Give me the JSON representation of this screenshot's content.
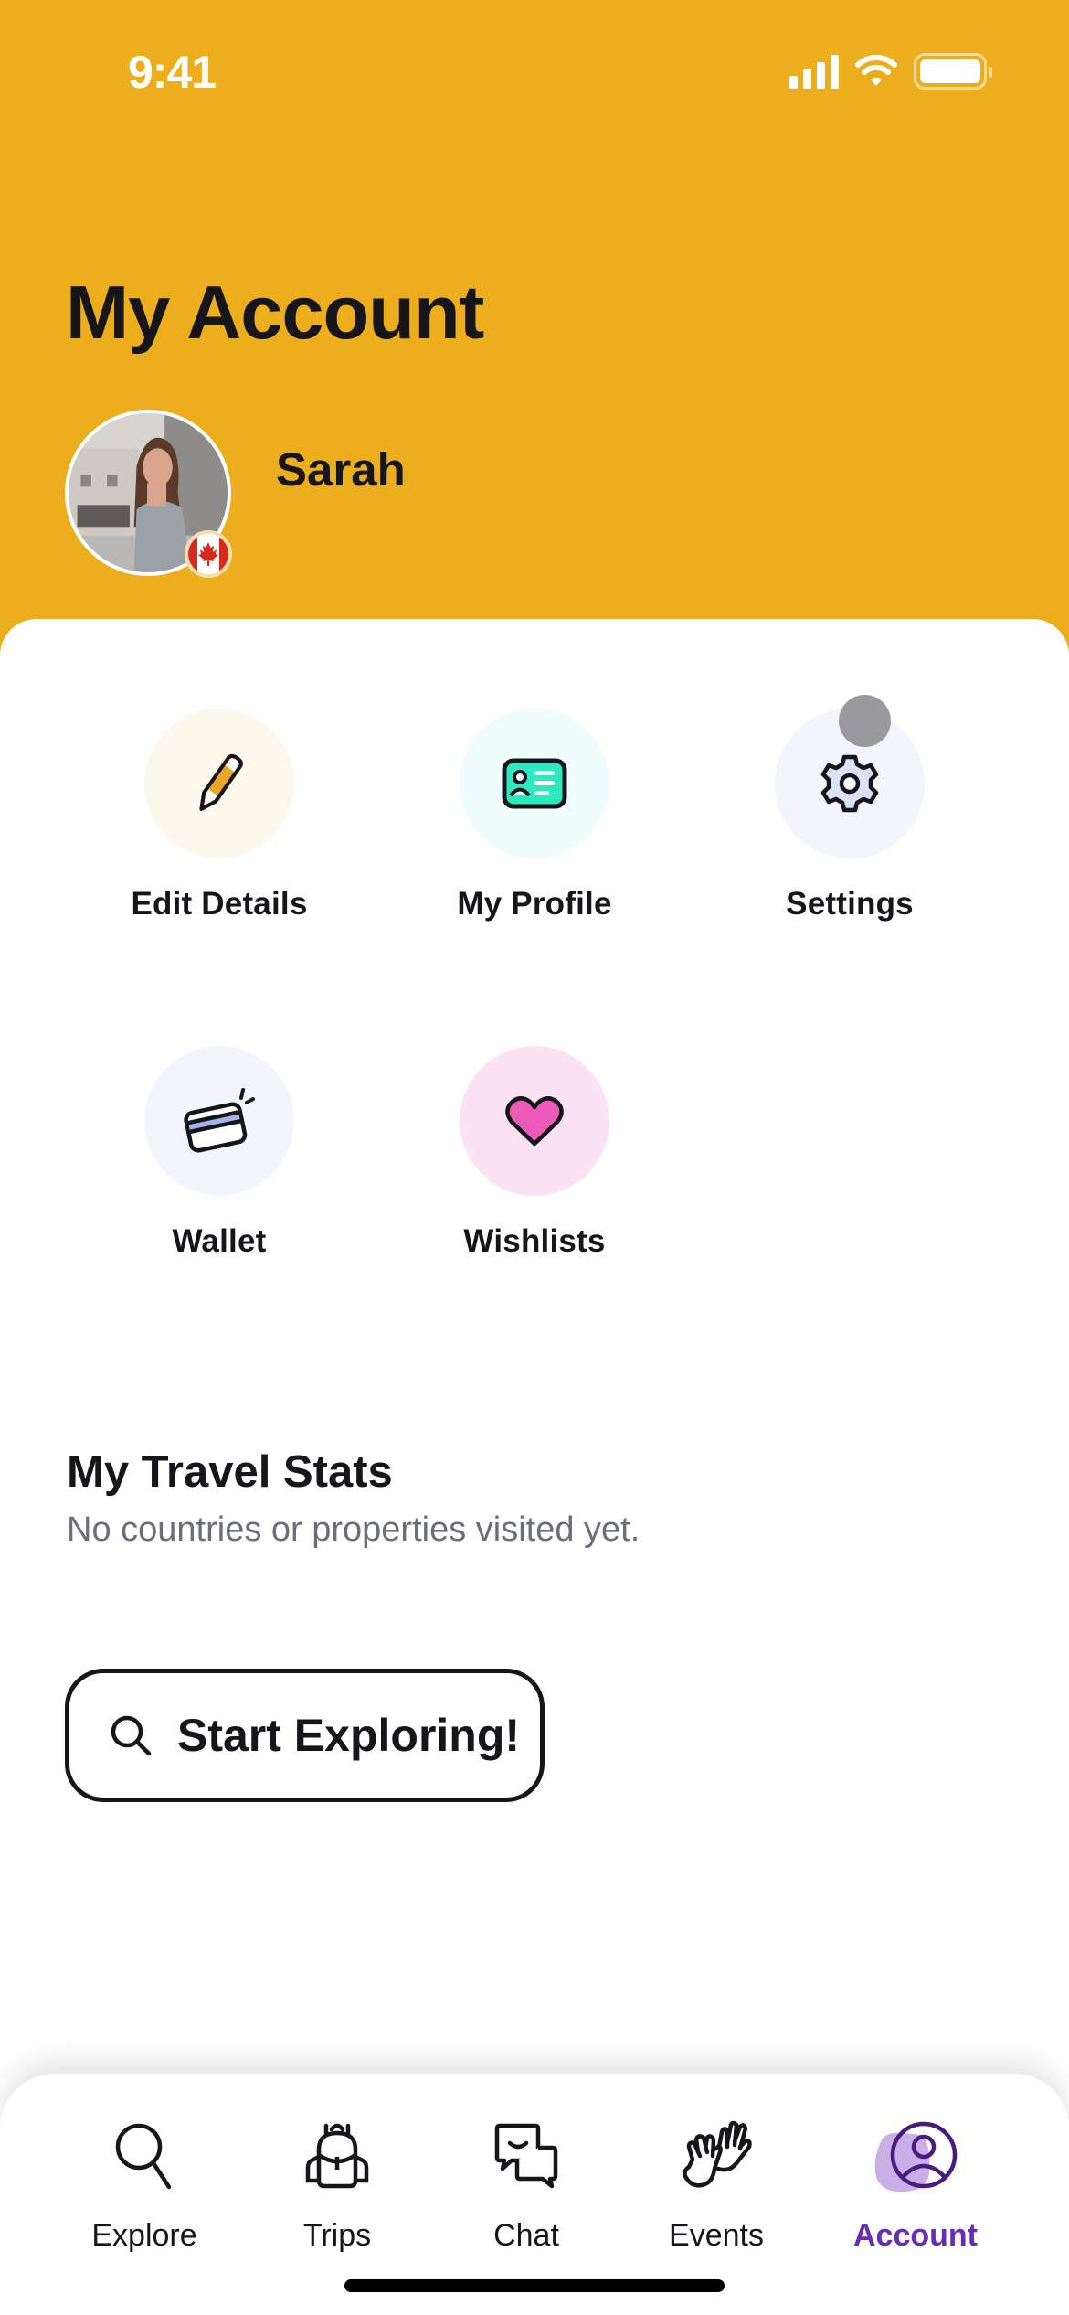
{
  "status_bar": {
    "time": "9:41",
    "icons": [
      "cellular-signal-icon",
      "wifi-icon",
      "battery-icon"
    ]
  },
  "header": {
    "title": "My Account",
    "user": {
      "name": "Sarah",
      "avatar": "profile-photo",
      "country_flag": "Canada"
    }
  },
  "colors": {
    "header_bg": "#ecae1c",
    "accent_purple": "#6a2bb8",
    "text_primary": "#16161a",
    "text_secondary": "#6b6d7a"
  },
  "quick_actions": [
    {
      "label": "Edit Details",
      "icon": "pencil-icon",
      "bg": "#fdf8ec"
    },
    {
      "label": "My Profile",
      "icon": "id-card-icon",
      "bg": "#effefd"
    },
    {
      "label": "Settings",
      "icon": "gear-icon",
      "bg": "#f2f5fe"
    },
    {
      "label": "Wallet",
      "icon": "credit-card-icon",
      "bg": "#f2f5fe"
    },
    {
      "label": "Wishlists",
      "icon": "heart-icon",
      "bg": "#fbe3f5"
    }
  ],
  "travel_stats": {
    "title": "My Travel Stats",
    "subtitle": "No countries or properties visited yet."
  },
  "explore_button": {
    "label": "Start Exploring!",
    "icon": "search-icon"
  },
  "tab_bar": {
    "active": "Account",
    "tabs": [
      {
        "label": "Explore",
        "icon": "search-icon"
      },
      {
        "label": "Trips",
        "icon": "backpack-icon"
      },
      {
        "label": "Chat",
        "icon": "chat-bubbles-icon"
      },
      {
        "label": "Events",
        "icon": "high-five-icon"
      },
      {
        "label": "Account",
        "icon": "user-circle-icon"
      }
    ]
  }
}
